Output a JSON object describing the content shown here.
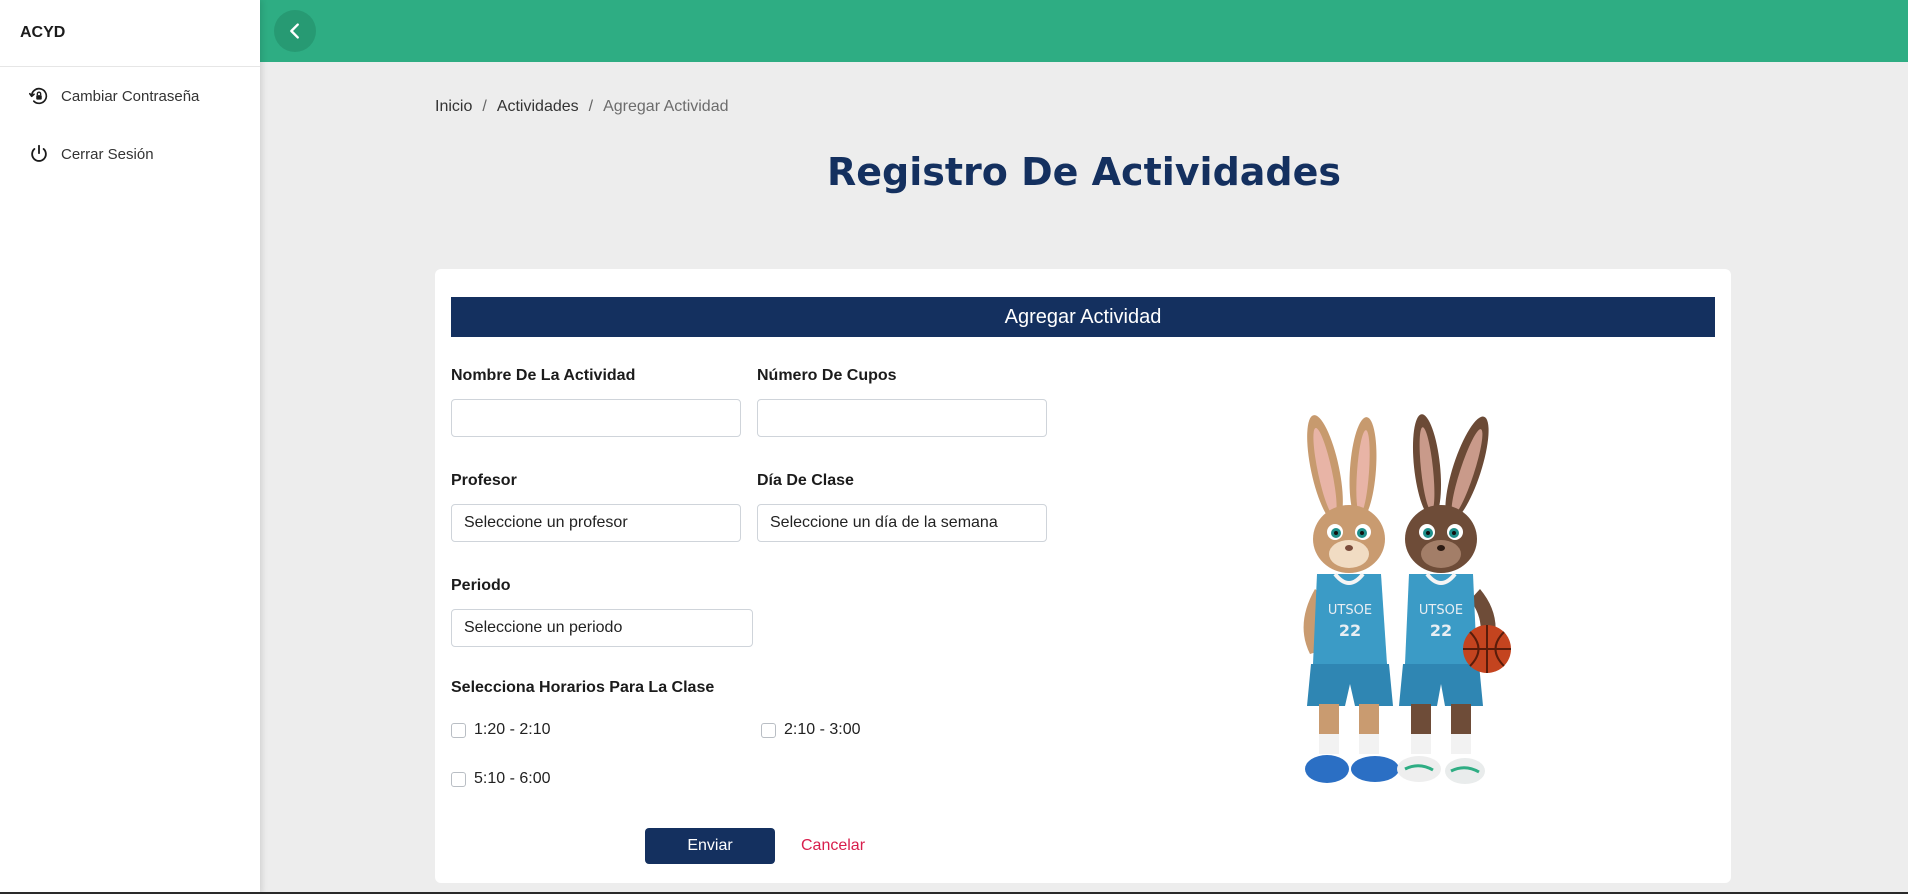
{
  "sidebar": {
    "brand": "ACYD",
    "items": [
      {
        "label": "Cambiar Contraseña",
        "icon": "lock-reset-icon"
      },
      {
        "label": "Cerrar Sesión",
        "icon": "power-icon"
      }
    ]
  },
  "topbar": {
    "back_icon": "chevron-left-icon",
    "color": "#2ead83"
  },
  "breadcrumb": [
    "Inicio",
    "Actividades",
    "Agregar Actividad"
  ],
  "page_title": "Registro De Actividades",
  "form": {
    "header": "Agregar Actividad",
    "nombre": {
      "label": "Nombre De La Actividad",
      "value": ""
    },
    "cupos": {
      "label": "Número De Cupos",
      "value": ""
    },
    "profesor": {
      "label": "Profesor",
      "selected": "Seleccione un profesor"
    },
    "dia": {
      "label": "Día De Clase",
      "selected": "Seleccione un día de la semana"
    },
    "periodo": {
      "label": "Periodo",
      "selected": "Seleccione un periodo"
    },
    "horarios_title": "Selecciona Horarios Para La Clase",
    "horarios": [
      {
        "label": "1:20 - 2:10",
        "checked": false
      },
      {
        "label": "2:10 - 3:00",
        "checked": false
      },
      {
        "label": "5:10 - 6:00",
        "checked": false
      }
    ],
    "submit_label": "Enviar",
    "cancel_label": "Cancelar"
  },
  "mascot_image": {
    "jersey_text": "UTSOE",
    "number": "22"
  },
  "colors": {
    "primary": "#14305f",
    "accent": "#2ead83",
    "cancel": "#d81e4c"
  }
}
